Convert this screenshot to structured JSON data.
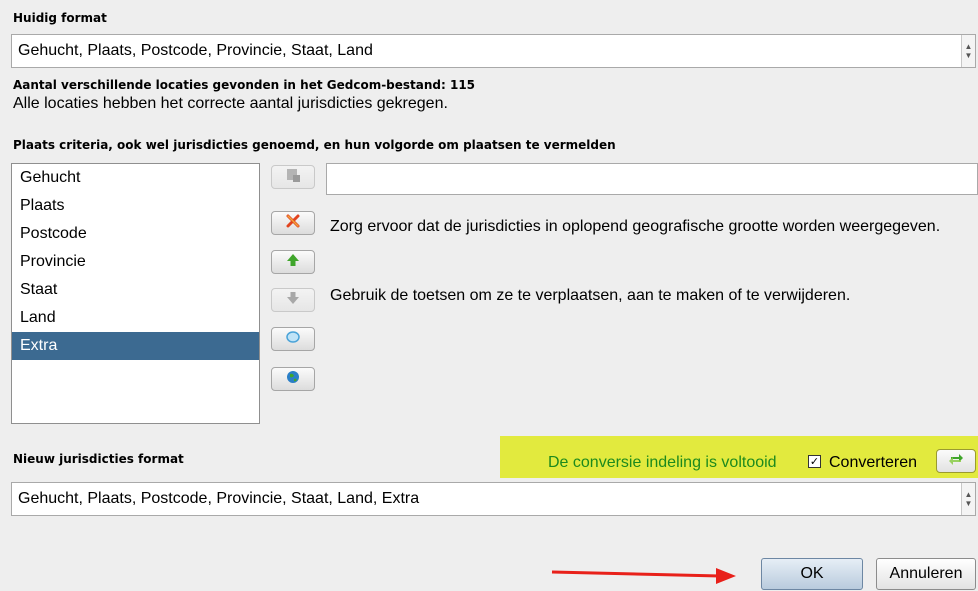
{
  "current_format": {
    "label": "Huidig format",
    "value": "Gehucht, Plaats, Postcode, Provincie, Staat, Land"
  },
  "info": {
    "count_text": "Aantal verschillende locaties gevonden in het Gedcom-bestand: 115",
    "status_text": "Alle locaties hebben het correcte aantal jurisdicties gekregen."
  },
  "criteria": {
    "label": "Plaats criteria, ook wel jurisdicties genoemd, en hun volgorde om plaatsen te vermelden",
    "items": [
      {
        "label": "Gehucht"
      },
      {
        "label": "Plaats"
      },
      {
        "label": "Postcode"
      },
      {
        "label": "Provincie"
      },
      {
        "label": "Staat"
      },
      {
        "label": "Land"
      },
      {
        "label": "Extra"
      }
    ],
    "selected_index": 6,
    "edit_value": "",
    "help_1": "Zorg ervoor dat de jurisdicties in oplopend geografische grootte worden weergegeven.",
    "help_2": "Gebruik de toetsen om ze te verplaatsen, aan te maken of te verwijderen."
  },
  "new_format": {
    "label": "Nieuw jurisdicties format",
    "value": "Gehucht, Plaats, Postcode, Provincie, Staat, Land, Extra"
  },
  "conversion": {
    "status_text": "De conversie indeling is voltooid",
    "checkbox_label": "Converteren",
    "checked": true
  },
  "buttons": {
    "ok": "OK",
    "cancel": "Annuleren"
  },
  "colors": {
    "selection": "#3c6a91",
    "highlight": "#e2ea3e",
    "success_text": "#1d8a1d",
    "arrow": "#e8201a"
  },
  "icons": [
    "add-icon",
    "delete-icon",
    "move-up-icon",
    "move-down-icon",
    "search-icon",
    "globe-icon",
    "convert-icon"
  ]
}
